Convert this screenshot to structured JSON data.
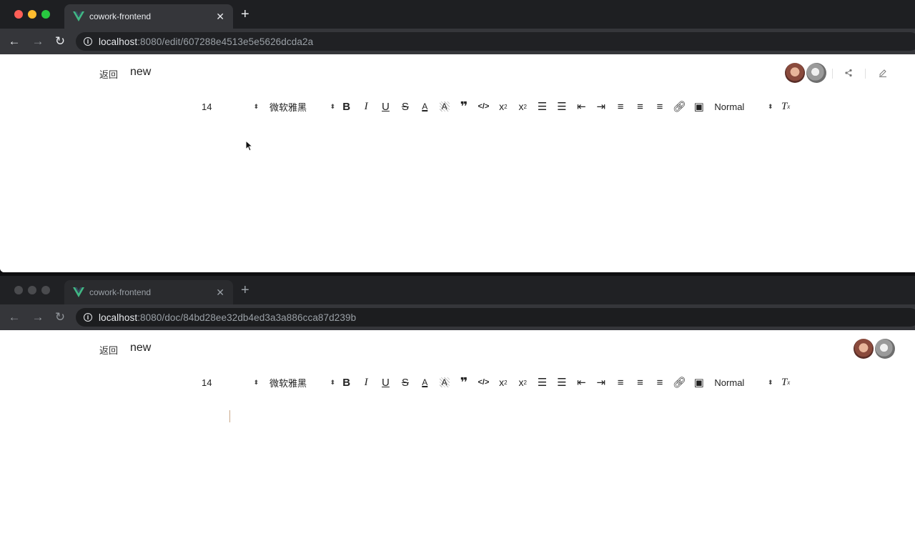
{
  "windows": [
    {
      "tab": {
        "title": "cowork-frontend"
      },
      "address": {
        "host": "localhost",
        "path": ":8080/edit/607288e4513e5e5626dcda2a"
      },
      "page": {
        "back_label": "返回",
        "doc_title": "new",
        "avatars": [
          "avatar-user-1",
          "avatar-user-2"
        ],
        "actions": [
          "share-icon",
          "edit-icon"
        ]
      },
      "toolbar": {
        "size": "14",
        "font": "微软雅黑",
        "header": "Normal"
      }
    },
    {
      "tab": {
        "title": "cowork-frontend"
      },
      "address": {
        "host": "localhost",
        "path": ":8080/doc/84bd28ee32db4ed3a3a886cca87d239b"
      },
      "page": {
        "back_label": "返回",
        "doc_title": "new",
        "avatars": [
          "avatar-user-1",
          "avatar-user-2"
        ]
      },
      "toolbar": {
        "size": "14",
        "font": "微软雅黑",
        "header": "Normal"
      }
    }
  ],
  "traffic_light_colors": [
    "#ff5f57",
    "#febc2e",
    "#28c840"
  ],
  "toolbar_icons": [
    "bold-icon",
    "italic-icon",
    "underline-icon",
    "strike-icon",
    "text-color-icon",
    "background-color-icon",
    "blockquote-icon",
    "code-icon",
    "subscript-icon",
    "superscript-icon",
    "ordered-list-icon",
    "bullet-list-icon",
    "outdent-icon",
    "indent-icon",
    "align-left-icon",
    "align-center-icon",
    "align-right-icon",
    "link-icon",
    "image-icon",
    "clear-format-icon"
  ]
}
